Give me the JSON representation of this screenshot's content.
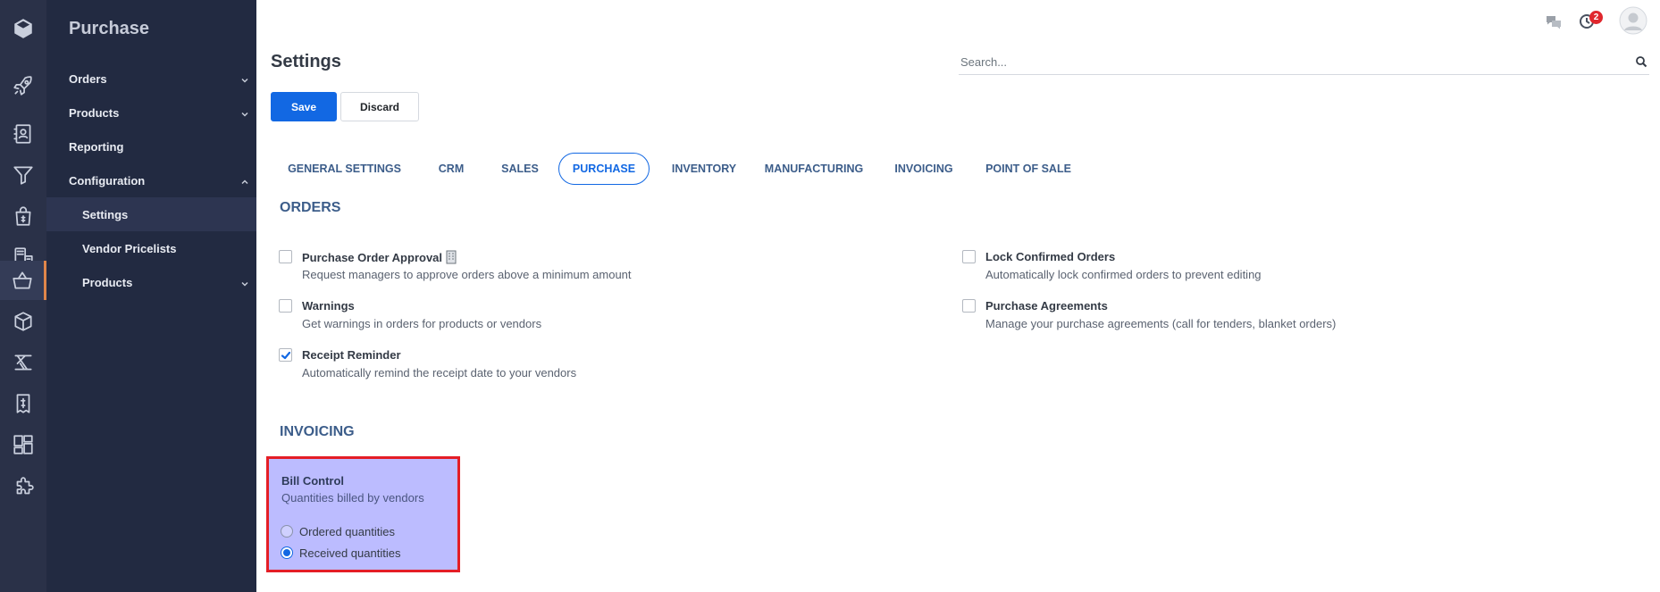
{
  "app": {
    "title": "Purchase"
  },
  "rail": {
    "icons": [
      "box-logo-icon",
      "rocket-icon",
      "contacts-icon",
      "funnel-icon",
      "shopping-bag-icon",
      "point-of-sale-icon",
      "basket-icon",
      "package-icon",
      "manufacturing-icon",
      "invoice-icon",
      "dashboard-icon",
      "puzzle-icon"
    ],
    "active": "basket-icon"
  },
  "sidebar": {
    "items": [
      {
        "label": "Orders"
      },
      {
        "label": "Products"
      },
      {
        "label": "Reporting"
      },
      {
        "label": "Configuration"
      },
      {
        "label": "Settings"
      },
      {
        "label": "Vendor Pricelists"
      },
      {
        "label": "Products"
      }
    ]
  },
  "topbar": {
    "chat_icon": "chat-icon",
    "activity_icon": "clock-icon",
    "activity_count": "2",
    "avatar": "avatar"
  },
  "page": {
    "title": "Settings"
  },
  "search": {
    "placeholder": "Search..."
  },
  "actions": {
    "save_label": "Save",
    "discard_label": "Discard"
  },
  "tabs": [
    {
      "label": "GENERAL SETTINGS"
    },
    {
      "label": "CRM"
    },
    {
      "label": "SALES"
    },
    {
      "label": "PURCHASE"
    },
    {
      "label": "INVENTORY"
    },
    {
      "label": "MANUFACTURING"
    },
    {
      "label": "INVOICING"
    },
    {
      "label": "POINT OF SALE"
    }
  ],
  "active_tab": "PURCHASE",
  "orders": {
    "title": "ORDERS",
    "settings": [
      {
        "title": "Purchase Order Approval",
        "desc": "Request managers to approve orders above a minimum amount",
        "checked": false
      },
      {
        "title": "Lock Confirmed Orders",
        "desc": "Automatically lock confirmed orders to prevent editing",
        "checked": false
      },
      {
        "title": "Warnings",
        "desc": "Get warnings in orders for products or vendors",
        "checked": false
      },
      {
        "title": "Purchase Agreements",
        "desc": "Manage your purchase agreements (call for tenders, blanket orders)",
        "checked": false
      },
      {
        "title": "Receipt Reminder",
        "desc": "Automatically remind the receipt date to your vendors",
        "checked": true
      }
    ]
  },
  "invoicing": {
    "title": "INVOICING",
    "bill_control": {
      "title": "Bill Control",
      "desc": "Quantities billed by vendors",
      "options": [
        {
          "label": "Ordered quantities",
          "selected": false
        },
        {
          "label": "Received quantities",
          "selected": true
        }
      ]
    }
  },
  "colors": {
    "accent": "#1268e3",
    "sidebar": "#222a41",
    "rail": "#2a3148",
    "highlight_border": "#e41e26",
    "highlight_fill": "#bcbcff"
  }
}
